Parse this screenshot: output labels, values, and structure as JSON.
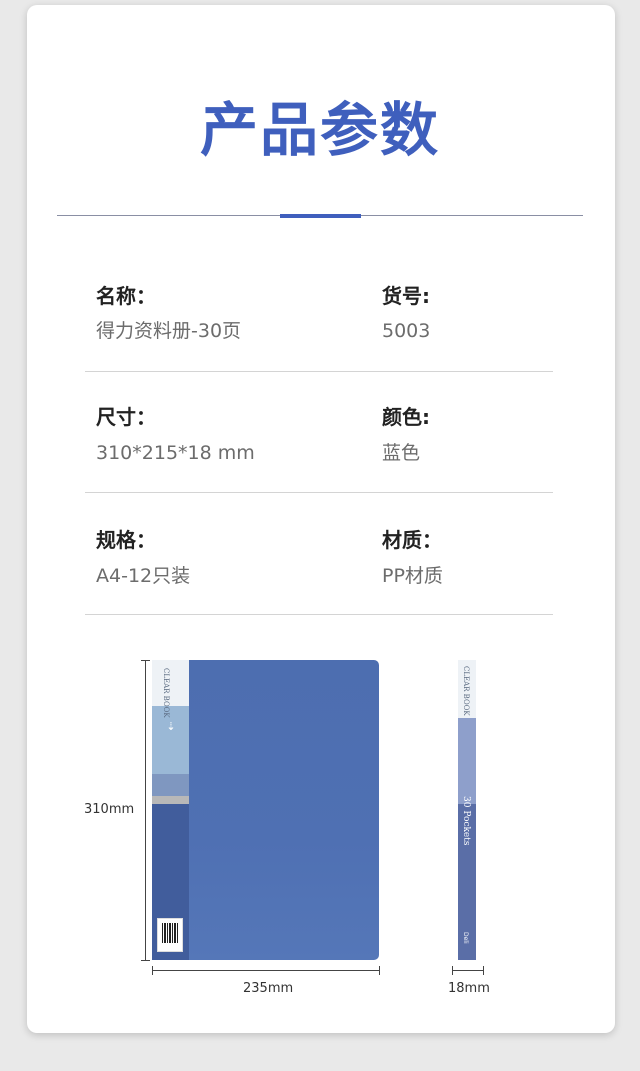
{
  "title": "产品参数",
  "specs": {
    "name": {
      "label": "名称：",
      "value": "得力资料册-30页"
    },
    "item_no": {
      "label": "货号:",
      "value": "5003"
    },
    "size": {
      "label": "尺寸：",
      "value": "310*215*18 mm"
    },
    "color": {
      "label": "颜色:",
      "value": "蓝色"
    },
    "spec": {
      "label": "规格：",
      "value": "A4-12只装"
    },
    "material": {
      "label": "材质：",
      "value": "PP材质"
    }
  },
  "product": {
    "spine_text": "CLEAR BOOK",
    "side_text": "CLEAR BOOK",
    "side_pages": "30 Pockets",
    "side_brand": "Deli",
    "height_label": "310mm",
    "width_label": "235mm",
    "thickness_label": "18mm"
  },
  "colors": {
    "accent": "#3f5fbd",
    "folder_blue": "#4d6eb0"
  }
}
